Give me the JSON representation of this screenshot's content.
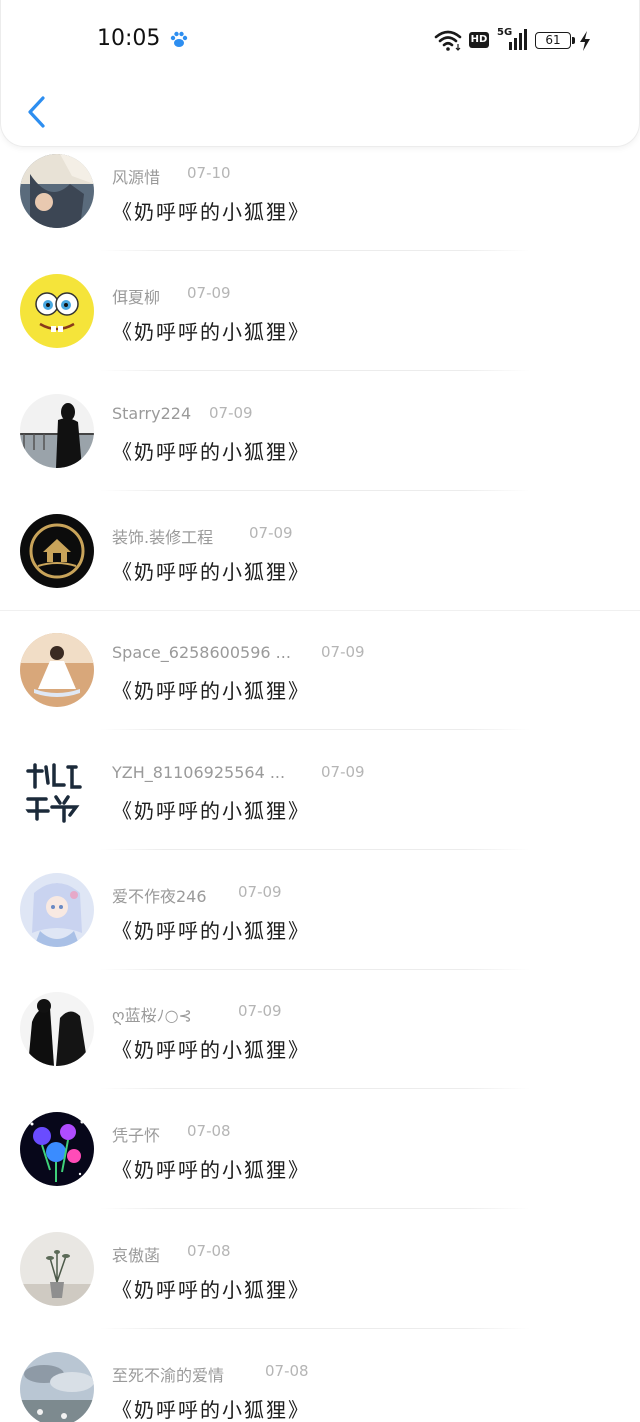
{
  "status_bar": {
    "time": "10:05",
    "network": "5G",
    "hd_label": "HD",
    "battery": "61"
  },
  "list": {
    "items": [
      {
        "username": "风源惜",
        "date": "07-10",
        "title": "《奶呼呼的小狐狸》",
        "avatar": "avatar-photo-person"
      },
      {
        "username": "佴夏柳",
        "date": "07-09",
        "title": "《奶呼呼的小狐狸》",
        "avatar": "avatar-spongebob"
      },
      {
        "username": "Starry224",
        "date": "07-09",
        "title": "《奶呼呼的小狐狸》",
        "avatar": "avatar-silhouette-girl"
      },
      {
        "username": "装饰.装修工程",
        "date": "07-09",
        "title": "《奶呼呼的小狐狸》",
        "avatar": "avatar-house-logo"
      },
      {
        "username": "Space_6258600596 ...",
        "date": "07-09",
        "title": "《奶呼呼的小狐狸》",
        "avatar": "avatar-dress-figure"
      },
      {
        "username": "YZH_81106925564 ...",
        "date": "07-09",
        "title": "《奶呼呼的小狐狸》",
        "avatar": "avatar-calligraphy"
      },
      {
        "username": "爱不作夜246",
        "date": "07-09",
        "title": "《奶呼呼的小狐狸》",
        "avatar": "avatar-anime-girl"
      },
      {
        "username": "ღ蓝桜ﾉ○⊰",
        "date": "07-09",
        "title": "《奶呼呼的小狐狸》",
        "avatar": "avatar-black-figures"
      },
      {
        "username": "凭子怀",
        "date": "07-08",
        "title": "《奶呼呼的小狐狸》",
        "avatar": "avatar-neon-flower"
      },
      {
        "username": "哀傲菡",
        "date": "07-08",
        "title": "《奶呼呼的小狐狸》",
        "avatar": "avatar-vase-plant"
      },
      {
        "username": "至死不渝的爱情",
        "date": "07-08",
        "title": "《奶呼呼的小狐狸》",
        "avatar": "avatar-sky-clouds"
      }
    ]
  },
  "colors": {
    "accent": "#2d8ef0",
    "username": "#9a9a9a",
    "date": "#b5b5b5",
    "title": "#1c1c1c"
  }
}
